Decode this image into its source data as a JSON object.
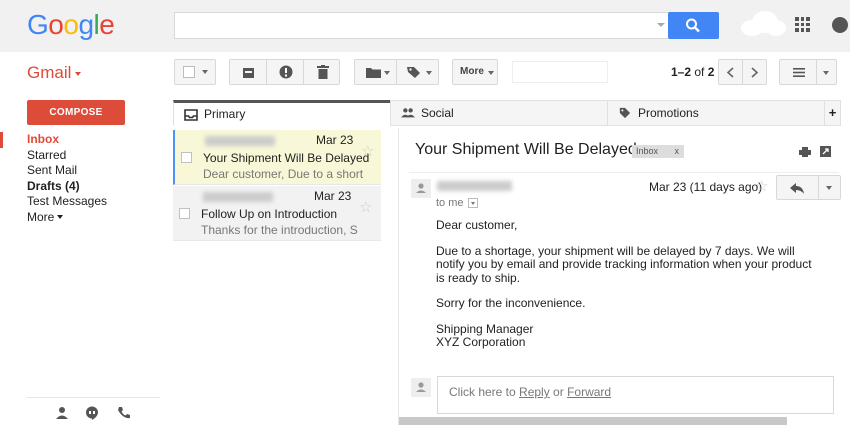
{
  "logo": {
    "letters": [
      "G",
      "o",
      "o",
      "g",
      "l",
      "e"
    ],
    "colors": [
      "#4285f4",
      "#ea4335",
      "#fbbc05",
      "#4285f4",
      "#34a853",
      "#ea4335"
    ]
  },
  "search": {
    "value": "",
    "placeholder": ""
  },
  "header": {
    "app_label": "Gmail"
  },
  "toolbar": {
    "more_label": "More",
    "pager_range": "1–2",
    "pager_of": " of ",
    "pager_total": "2"
  },
  "compose_label": "COMPOSE",
  "nav": {
    "inbox": "Inbox",
    "starred": "Starred",
    "sent": "Sent Mail",
    "drafts": "Drafts (4)",
    "test": "Test Messages",
    "more": "More"
  },
  "tabs": {
    "primary": "Primary",
    "social": "Social",
    "promotions": "Promotions",
    "add": "+"
  },
  "emails": [
    {
      "date": "Mar 23",
      "subject": "Your Shipment Will Be Delayed",
      "snippet": "Dear customer, Due to a short"
    },
    {
      "date": "Mar 23",
      "subject": "Follow Up on Introduction",
      "snippet": "Thanks for the introduction, S"
    }
  ],
  "message": {
    "title": "Your Shipment Will Be Delayed",
    "badge": "Inbox",
    "badge_close": "x",
    "to": "to me",
    "date": "Mar 23 (11 days ago)",
    "greeting": "Dear customer,",
    "para1": "Due to a shortage, your shipment will be delayed by 7 days. We will notify you by email and provide tracking information when your product is ready to ship.",
    "para2": "Sorry for the inconvenience.",
    "sig1": "Shipping Manager",
    "sig2": "XYZ Corporation"
  },
  "reply_box": {
    "prefix": "Click here to ",
    "reply": "Reply",
    "or": " or ",
    "forward": "Forward"
  },
  "colors": {
    "accent_red": "#dd4b39",
    "search_blue": "#4285f4",
    "selected_row": "#f8f8d8"
  }
}
